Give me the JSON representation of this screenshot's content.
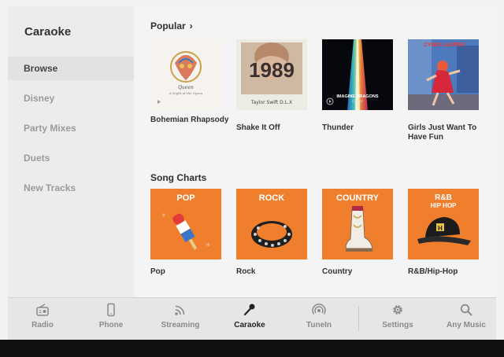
{
  "app": {
    "title": "Caraoke"
  },
  "sidebar": {
    "items": [
      {
        "label": "Browse",
        "active": true
      },
      {
        "label": "Disney",
        "active": false
      },
      {
        "label": "Party Mixes",
        "active": false
      },
      {
        "label": "Duets",
        "active": false
      },
      {
        "label": "New Tracks",
        "active": false
      }
    ]
  },
  "popular": {
    "title": "Popular",
    "items": [
      {
        "label": "Bohemian Rhapsody",
        "art_text": "Queen",
        "art_subtext": "A Night at the Opera"
      },
      {
        "label": "Shake It Off",
        "art_text": "1989",
        "art_subtext": "Taylor Swift  D.L.X"
      },
      {
        "label": "Thunder",
        "art_text": "IMAGINE DRAGONS",
        "art_subtext": "EVOLVE"
      },
      {
        "label": "Girls Just Want To Have Fun",
        "art_text": "CYNDI LAUPER"
      }
    ]
  },
  "charts": {
    "title": "Song Charts",
    "items": [
      {
        "label": "Pop",
        "art_text": "POP"
      },
      {
        "label": "Rock",
        "art_text": "ROCK"
      },
      {
        "label": "Country",
        "art_text": "COUNTRY"
      },
      {
        "label": "R&B/Hip-Hop",
        "art_text_1": "R&B",
        "art_text_2": "HIP HOP"
      }
    ]
  },
  "bottom_nav": {
    "items": [
      {
        "label": "Radio",
        "icon": "radio-icon"
      },
      {
        "label": "Phone",
        "icon": "phone-icon"
      },
      {
        "label": "Streaming",
        "icon": "streaming-icon"
      },
      {
        "label": "Caraoke",
        "icon": "microphone-icon",
        "active": true
      },
      {
        "label": "TuneIn",
        "icon": "tunein-icon"
      },
      {
        "label": "Settings",
        "icon": "gear-icon"
      },
      {
        "label": "Any Music",
        "icon": "search-icon"
      }
    ]
  },
  "colors": {
    "chart_orange": "#ef7f2d",
    "active_nav": "#222222",
    "inactive_nav": "#8a8a8a"
  }
}
